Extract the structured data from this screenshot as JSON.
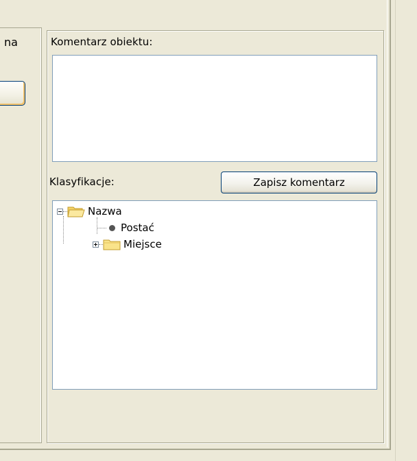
{
  "left_panel": {
    "partial_label": "na"
  },
  "comment": {
    "label": "Komentarz obiektu:",
    "value": ""
  },
  "classification": {
    "label": "Klasyfikacje:",
    "save_button_label": "Zapisz komentarz"
  },
  "tree": {
    "root": {
      "label": "Nazwa",
      "expanded": true,
      "icon": "folder-open-icon"
    },
    "children": [
      {
        "label": "Postać",
        "icon": "bullet-icon"
      },
      {
        "label": "Miejsce",
        "icon": "folder-icon",
        "expanded": false
      }
    ]
  },
  "colors": {
    "window_bg": "#ece9d8",
    "field_border": "#7f9db9",
    "button_border": "#003c74",
    "folder_fill": "#f9e38a"
  }
}
